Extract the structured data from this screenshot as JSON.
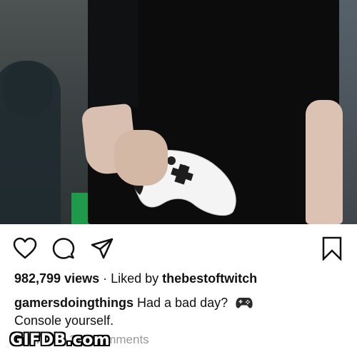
{
  "post": {
    "views_count": "982,799 views",
    "separator": " · ",
    "liked_by_prefix": "Liked by ",
    "liked_by_user": "thebestoftwitch",
    "caption_user": "gamersdoingthings",
    "caption_text": " Had a bad day? ",
    "caption_emoji_icon": "gamepad-icon",
    "caption_line2": "Console yourself.",
    "comments_link": "View all 9,377 comments",
    "media_description_icon": "video-still"
  },
  "actions": {
    "like_icon": "heart-icon",
    "comment_icon": "comment-icon",
    "share_icon": "paper-plane-icon",
    "save_icon": "bookmark-icon"
  },
  "watermark": {
    "text": "GIFDB.com"
  }
}
